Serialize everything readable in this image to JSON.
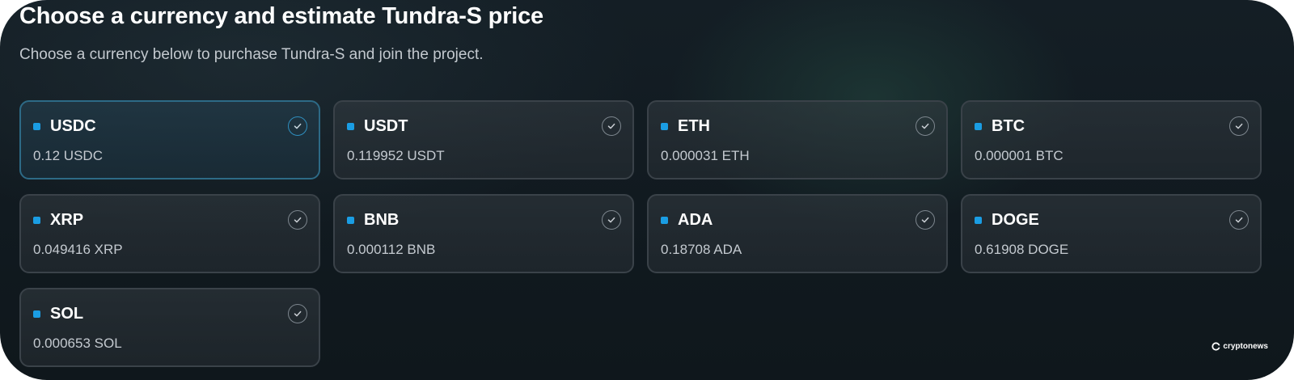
{
  "header": {
    "title": "Choose a currency and estimate Tundra-S price",
    "subtitle": "Choose a currency below to purchase Tundra-S and join the project."
  },
  "currencies": [
    {
      "name": "USDC",
      "price": "0.12 USDC",
      "selected": true
    },
    {
      "name": "USDT",
      "price": "0.119952 USDT",
      "selected": false
    },
    {
      "name": "ETH",
      "price": "0.000031 ETH",
      "selected": false
    },
    {
      "name": "BTC",
      "price": "0.000001 BTC",
      "selected": false
    },
    {
      "name": "XRP",
      "price": "0.049416 XRP",
      "selected": false
    },
    {
      "name": "BNB",
      "price": "0.000112 BNB",
      "selected": false
    },
    {
      "name": "ADA",
      "price": "0.18708 ADA",
      "selected": false
    },
    {
      "name": "DOGE",
      "price": "0.61908 DOGE",
      "selected": false
    },
    {
      "name": "SOL",
      "price": "0.000653 SOL",
      "selected": false
    }
  ],
  "icons": {
    "currency_marker": "square-dot-icon",
    "select_indicator": "check-circle-icon",
    "watermark_logo": "cryptonews-logo-icon"
  },
  "colors": {
    "accent": "#1a9de3",
    "selected_border": "#2d6a86",
    "background": "#121b21"
  },
  "watermark": {
    "text": "cryptonews"
  }
}
